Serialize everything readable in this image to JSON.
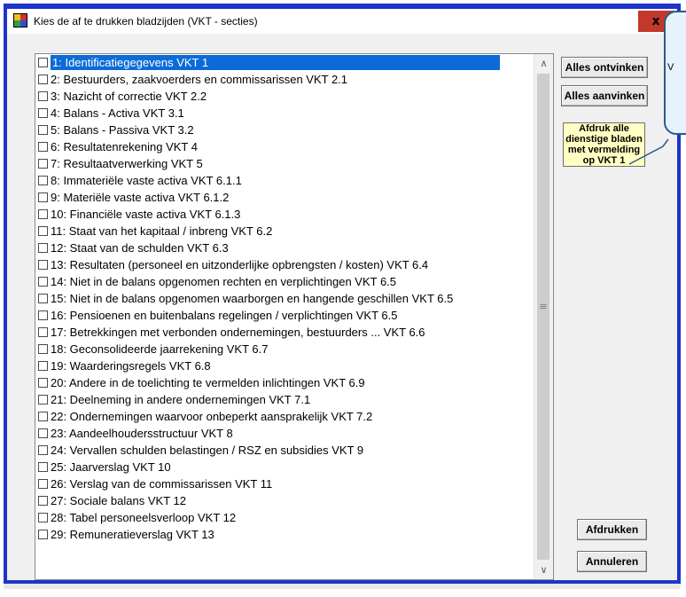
{
  "window": {
    "title": "Kies de af te drukken bladzijden (VKT - secties)",
    "close_label": "x"
  },
  "buttons": {
    "uncheck_all": "Alles ontvinken",
    "check_all": "Alles aanvinken",
    "print_all_sheets": "Afdruk alle dienstige bladen met vermelding op VKT 1",
    "print": "Afdrukken",
    "cancel": "Annuleren"
  },
  "tooltip": {
    "text": "V"
  },
  "list": {
    "selected_index": 0,
    "items": [
      "1:  Identificatiegegevens VKT 1",
      "2:  Bestuurders, zaakvoerders en commissarissen VKT 2.1",
      "3:  Nazicht of correctie VKT 2.2",
      "4:  Balans  - Activa VKT 3.1",
      "5:  Balans - Passiva VKT 3.2",
      "6:  Resultatenrekening VKT 4",
      "7:  Resultaatverwerking VKT 5",
      "8:  Immateriële vaste activa VKT 6.1.1",
      "9:  Materiële vaste activa VKT 6.1.2",
      "10:  Financiële vaste activa VKT 6.1.3",
      "11:  Staat van het kapitaal / inbreng VKT 6.2",
      "12:  Staat van de schulden VKT 6.3",
      "13:  Resultaten (personeel en uitzonderlijke opbrengsten / kosten) VKT 6.4",
      "14:  Niet in de balans opgenomen rechten en verplichtingen VKT 6.5",
      "15:  Niet in de balans opgenomen waarborgen en hangende geschillen VKT 6.5",
      "16:  Pensioenen en buitenbalans regelingen / verplichtingen VKT 6.5",
      "17:  Betrekkingen met verbonden ondernemingen, bestuurders ... VKT 6.6",
      "18:  Geconsolideerde jaarrekening VKT 6.7",
      "19:  Waarderingsregels VKT 6.8",
      "20:  Andere in de toelichting te vermelden inlichtingen VKT 6.9",
      "21:  Deelneming in andere ondernemingen VKT 7.1",
      "22:  Ondernemingen waarvoor onbeperkt aansprakelijk VKT 7.2",
      "23:  Aandeelhoudersstructuur VKT 8",
      "24:  Vervallen schulden belastingen / RSZ en subsidies VKT 9",
      "25:  Jaarverslag VKT 10",
      "26:  Verslag van de commissarissen VKT 11",
      "27:  Sociale balans VKT 12",
      "28:  Tabel personeelsverloop VKT 12",
      "29:  Remuneratieverslag VKT 13"
    ]
  },
  "colors": {
    "frame": "#1c35c8",
    "selection": "#0c6bd8",
    "close": "#c0392b",
    "highlight_button": "#ffffc3"
  },
  "icons": {
    "app": "app-icon",
    "scroll_up": "chevron-up-icon",
    "scroll_down": "chevron-down-icon",
    "scroll_grip": "grip-icon"
  }
}
